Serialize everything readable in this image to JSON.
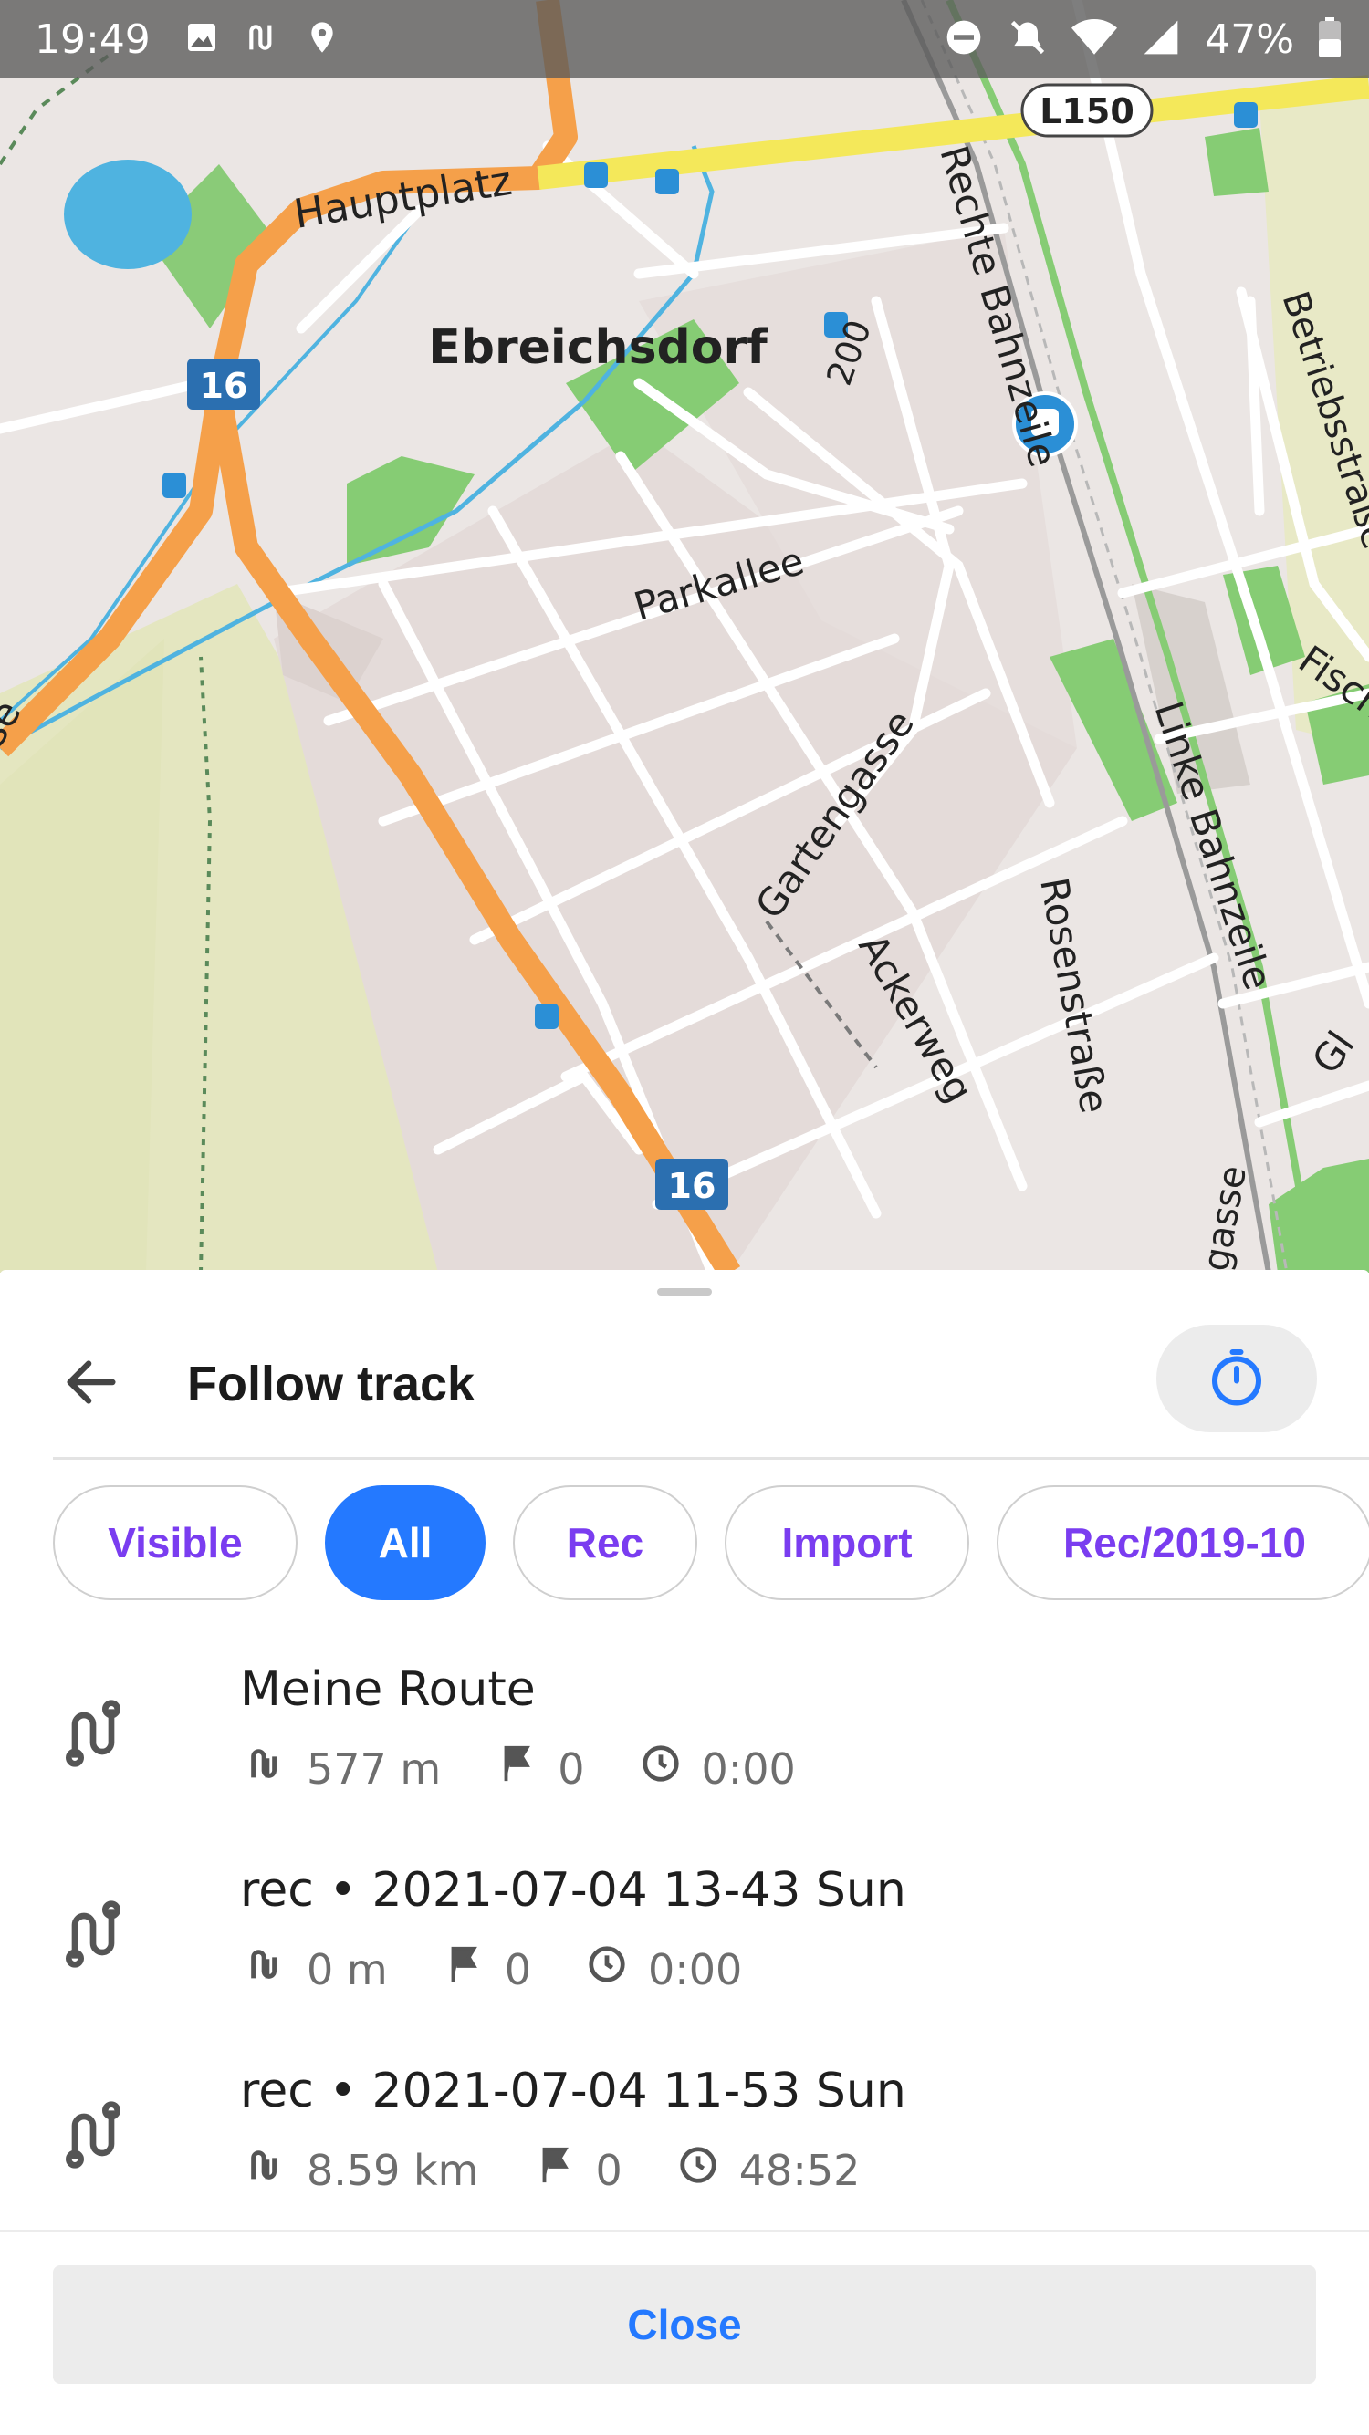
{
  "status_bar": {
    "time": "19:49",
    "battery": "47%",
    "icons_left": [
      "image-icon",
      "track-icon",
      "location-pin-icon"
    ],
    "icons_right": [
      "do-not-disturb-icon",
      "notifications-off-icon",
      "wifi-icon",
      "signal-icon",
      "battery-icon"
    ]
  },
  "map": {
    "place_name": "Ebreichsdorf",
    "road_labels": {
      "hauptplatz": "Hauptplatz",
      "l150": "L150",
      "route_16_top": "16",
      "route_16_bottom": "16",
      "rechte_bahnzeile": "Rechte Bahnzeile",
      "betriebsstrasse": "Betriebsstraße",
      "parkallee": "Parkallee",
      "gartengasse": "Gartengasse",
      "ackerweg": "Ackerweg",
      "rosenstrasse": "Rosenstraße",
      "linke_bahnzeile": "Linke Bahnzeile",
      "contour_200": "200",
      "fisch": "Fisch",
      "gasse": "gasse",
      "se": "se",
      "gl": "Gl"
    },
    "colors": {
      "land": "#f2efe9",
      "main_road": "#f5a04a",
      "l150": "#f4e85a",
      "water": "#4fb3e0",
      "park": "#86cc74",
      "farmland": "#e6e8c3",
      "rail": "#9a9a9a"
    }
  },
  "sheet": {
    "title": "Follow track",
    "back_icon": "arrow-left-icon",
    "timer_icon": "stopwatch-icon",
    "chips": [
      {
        "label": "Visible",
        "active": false
      },
      {
        "label": "All",
        "active": true
      },
      {
        "label": "Rec",
        "active": false
      },
      {
        "label": "Import",
        "active": false
      },
      {
        "label": "Rec/2019-10",
        "active": false
      }
    ],
    "tracks": [
      {
        "name": "Meine Route",
        "distance": "577 m",
        "waypoints": "0",
        "duration": "0:00"
      },
      {
        "name": "rec • 2021-07-04 13-43 Sun",
        "distance": "0 m",
        "waypoints": "0",
        "duration": "0:00"
      },
      {
        "name": "rec • 2021-07-04 11-53 Sun",
        "distance": "8.59 km",
        "waypoints": "0",
        "duration": "48:52"
      }
    ],
    "close_label": "Close",
    "accent_color": "#2479ff",
    "chip_text_color": "#7a3df0"
  }
}
